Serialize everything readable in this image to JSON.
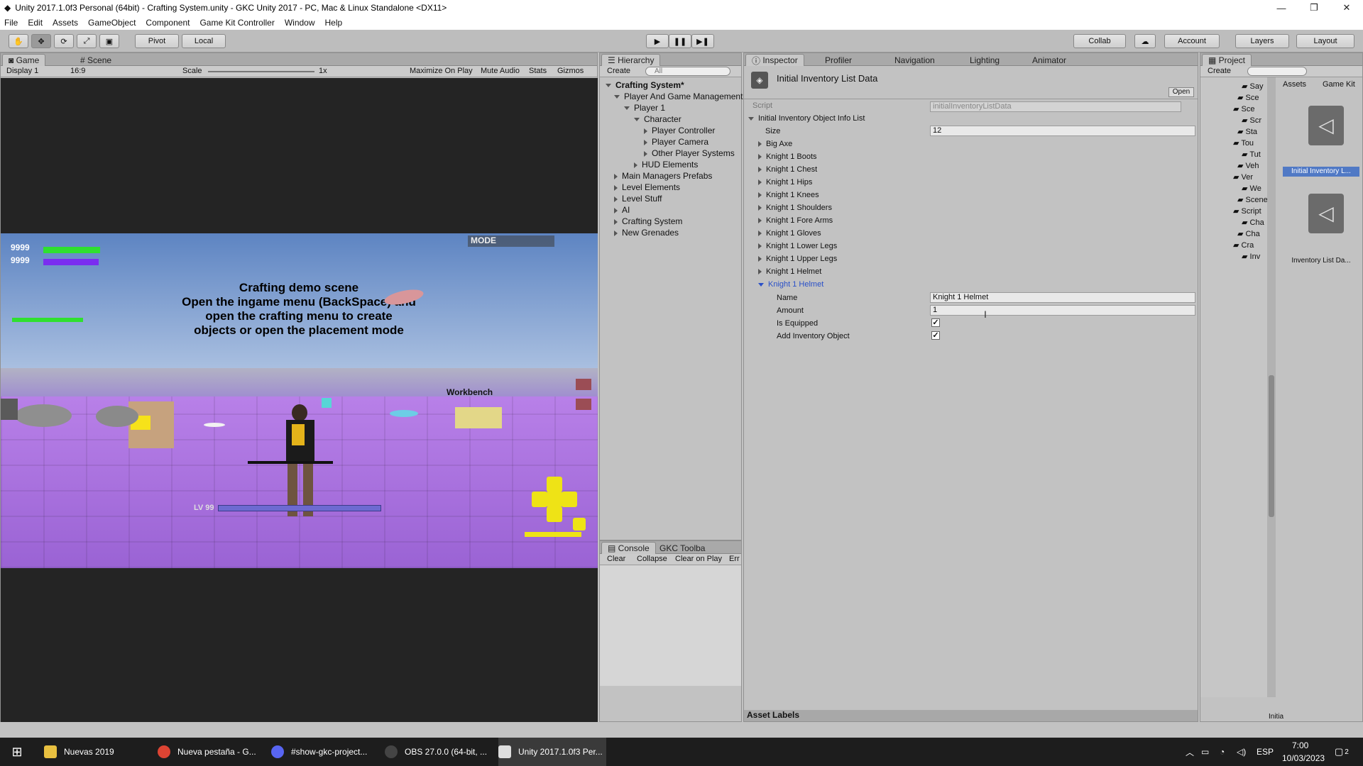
{
  "window": {
    "title": "Unity 2017.1.0f3 Personal (64bit) - Crafting System.unity - GKC Unity 2017 - PC, Mac & Linux Standalone <DX11>"
  },
  "menu": [
    "File",
    "Edit",
    "Assets",
    "GameObject",
    "Component",
    "Game Kit Controller",
    "Window",
    "Help"
  ],
  "toolbar": {
    "pivot": "Pivot",
    "local": "Local",
    "collab": "Collab",
    "account": "Account",
    "layers": "Layers",
    "layout": "Layout"
  },
  "game": {
    "tabs": [
      "Game",
      "Scene"
    ],
    "display": "Display 1",
    "aspect": "16:9",
    "scale_label": "Scale",
    "scale_value": "1x",
    "buttons": [
      "Maximize On Play",
      "Mute Audio",
      "Stats",
      "Gizmos"
    ],
    "hud": {
      "health": "9999",
      "shield": "9999",
      "mode": "MODE",
      "level": "LV 99",
      "workbench": "Workbench"
    },
    "overlay": [
      "Crafting demo scene",
      "Open the ingame menu (BackSpace) and",
      "open the crafting menu to create",
      "objects or open the placement mode"
    ]
  },
  "hierarchy": {
    "tab": "Hierarchy",
    "create": "Create",
    "search": "All",
    "scene": "Crafting System*",
    "items": [
      "Player And Game Management",
      "Player 1",
      "Character",
      "Player Controller",
      "Player Camera",
      "Other Player Systems",
      "HUD Elements",
      "Main Managers Prefabs",
      "Level Elements",
      "Level Stuff",
      "AI",
      "Crafting System",
      "New Grenades"
    ]
  },
  "console": {
    "tabs": [
      "Console",
      "GKC Toolba"
    ],
    "buttons": [
      "Clear",
      "Collapse",
      "Clear on Play",
      "Err"
    ]
  },
  "inspector": {
    "tabs": [
      "Inspector",
      "Profiler",
      "Navigation",
      "Lighting",
      "Animator"
    ],
    "title": "Initial Inventory List Data",
    "open": "Open",
    "script_label": "Script",
    "script_value": "initialInventoryListData",
    "list_label": "Initial Inventory Object Info List",
    "size_label": "Size",
    "size_value": "12",
    "elements": [
      "Big Axe",
      "Knight 1 Boots",
      "Knight 1 Chest",
      "Knight 1 Hips",
      "Knight 1 Knees",
      "Knight 1 Shoulders",
      "Knight 1 Fore Arms",
      "Knight 1 Gloves",
      "Knight 1 Lower Legs",
      "Knight 1 Upper Legs",
      "Knight 1 Helmet",
      "Knight 1 Helmet"
    ],
    "expanded": {
      "name_label": "Name",
      "name_value": "Knight 1 Helmet",
      "amount_label": "Amount",
      "amount_value": "1",
      "equipped_label": "Is Equipped",
      "add_label": "Add Inventory Object"
    },
    "asset_labels": "Asset Labels"
  },
  "project": {
    "tab": "Project",
    "create": "Create",
    "breadcrumb": [
      "Assets",
      "Game Kit"
    ],
    "assets": [
      "Initial Inventory L...",
      "Inventory List Da..."
    ],
    "folders": [
      "Say",
      "Sce",
      "Sce",
      "Scr",
      "Sta",
      "Tou",
      "Tut",
      "Veh",
      "Ver",
      "We",
      "Scene",
      "Script",
      "Cha",
      "Cha",
      "Cra",
      "Inv"
    ],
    "bottom": "Initia"
  },
  "taskbar": {
    "items": [
      "Nuevas 2019",
      "Nueva pestaña - G...",
      "#show-gkc-project...",
      "OBS 27.0.0 (64-bit, ...",
      "Unity 2017.1.0f3 Per..."
    ],
    "lang": "ESP",
    "time": "7:00",
    "date": "10/03/2023",
    "notif": "2"
  }
}
